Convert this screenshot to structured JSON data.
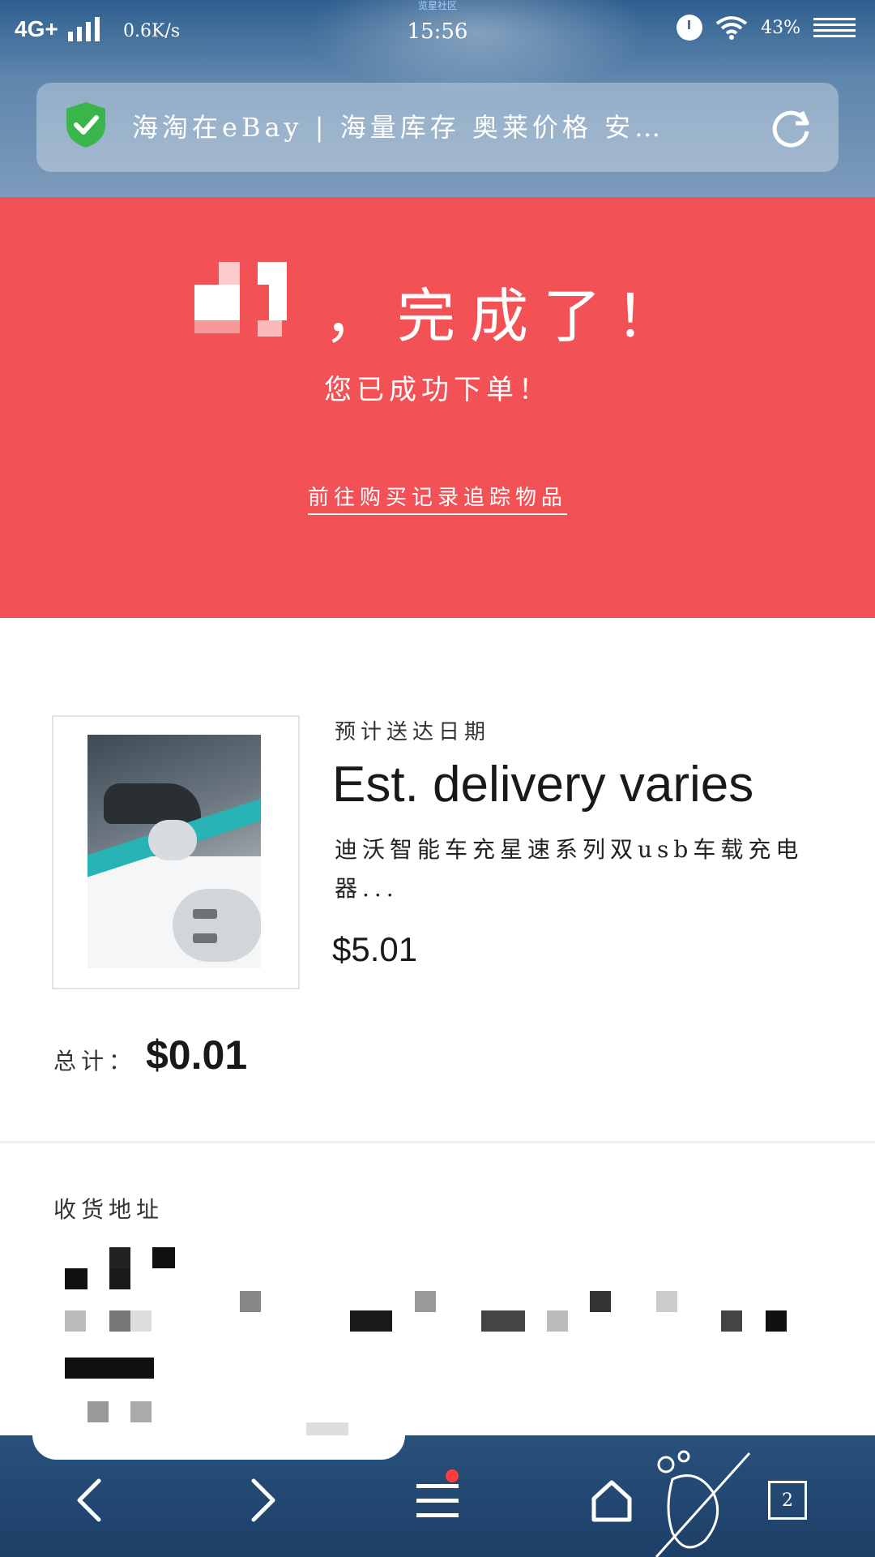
{
  "status_bar": {
    "network": "4G+",
    "speed": "0.6K/s",
    "time": "15:56",
    "carrier_note": "览星社区",
    "battery": "43%"
  },
  "address_bar": {
    "title": "海淘在eBay | 海量库存 奥莱价格 安…"
  },
  "banner": {
    "headline": "，完成了！",
    "subtitle": "您已成功下单！",
    "track_link": "前往购买记录追踪物品",
    "bg_color": "#f25155"
  },
  "item": {
    "delivery_label": "预计送达日期",
    "delivery_value": "Est. delivery varies",
    "title": "迪沃智能车充星速系列双usb车载充电器...",
    "price": "$5.01"
  },
  "total": {
    "label": "总计：",
    "value": "$0.01"
  },
  "shipping": {
    "label": "收货地址"
  },
  "bottom_nav": {
    "tab_count": "2"
  }
}
